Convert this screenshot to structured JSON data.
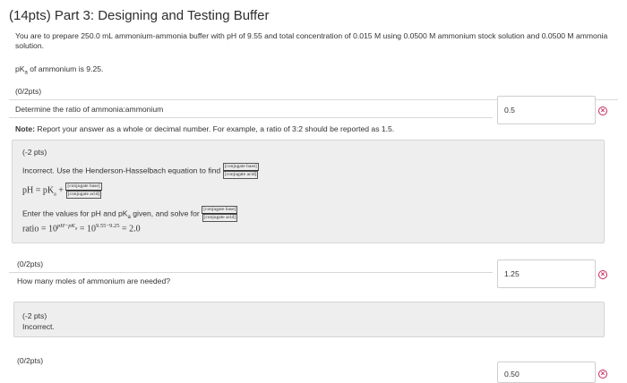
{
  "page": {
    "title": "(14pts) Part 3: Designing and Testing Buffer",
    "intro": "You are to prepare 250.0 mL ammonium-ammonia buffer with pH of 9.55 and total concentration of 0.015 M using 0.0500 M ammonium stock solution and 0.0500 M ammonia solution.",
    "pka_pre": "pK",
    "pka_sub": "a",
    "pka_post": " of ammonium is 9.25."
  },
  "q1": {
    "score": "(0/2pts)",
    "prompt": "Determine the ratio of ammonia:ammonium",
    "answer": "0.5",
    "note_label": "Note:",
    "note_text": " Report your answer as a whole or decimal number. For example, a ratio of 3:2 should be reported as 1.5.",
    "feedback": {
      "points": "(-2 pts)",
      "line1": "Incorrect. Use the Henderson-Hasselbach equation to find",
      "frac_num": "[conjugate base]",
      "frac_den": "[conjugate acid]",
      "eq1_lhs": "pH = pK",
      "eq1_sub": "a",
      "eq1_plus": " + ",
      "line3": "Enter the values for pH and pK",
      "line3_sub": "a",
      "line3_post": " given, and solve for",
      "ratio_text": "ratio = 10",
      "ratio_exp": "pH−pK",
      "ratio_exp_sub": "a",
      "ratio_mid": " = 10",
      "ratio_exp2": "9.55−9.25",
      "ratio_end": " = 2.0"
    }
  },
  "q2": {
    "score": "(0/2pts)",
    "prompt": "How many moles of ammonium are needed?",
    "answer": "1.25",
    "feedback": {
      "points": "(-2 pts)",
      "text": "Incorrect."
    }
  },
  "q3": {
    "score": "(0/2pts)",
    "answer": "0.50"
  },
  "icons": {
    "incorrect": "x-circle-icon",
    "color": "#c8285d"
  }
}
